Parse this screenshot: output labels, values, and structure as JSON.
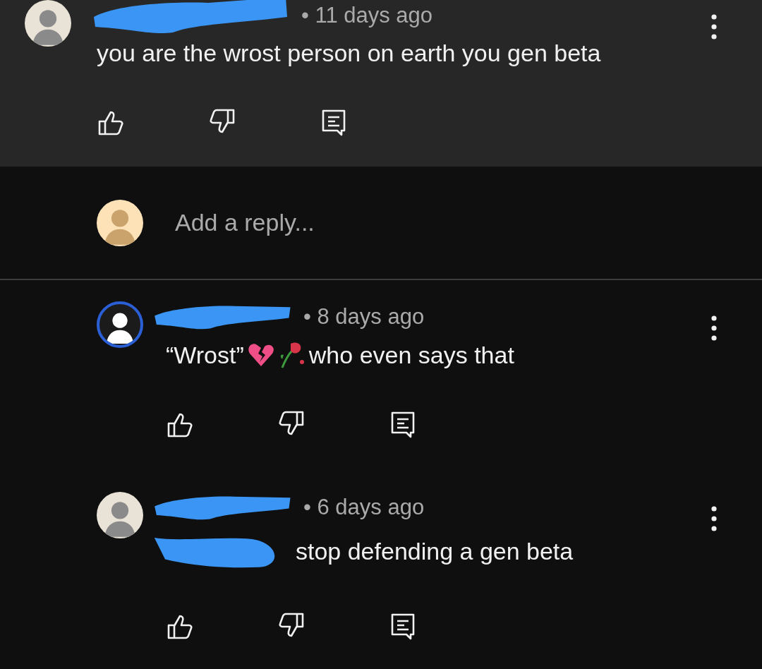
{
  "comment": {
    "author_redacted": true,
    "meta": "• 11 days ago",
    "body": [
      {
        "kind": "text",
        "text": "you are the wrost person on earth you gen beta"
      }
    ]
  },
  "reply_box": {
    "placeholder": "Add a reply..."
  },
  "replies": [
    {
      "author_redacted": true,
      "meta": "• 8 days ago",
      "mention_redacted": false,
      "body": [
        {
          "kind": "text",
          "text": "“Wrost”"
        },
        {
          "kind": "broken-heart"
        },
        {
          "kind": "wilted-rose"
        },
        {
          "kind": "text",
          "text": "who even says that"
        }
      ]
    },
    {
      "author_redacted": true,
      "meta": "• 6 days ago",
      "mention_redacted": true,
      "body": [
        {
          "kind": "text",
          "text": "stop defending a gen beta"
        }
      ]
    }
  ]
}
